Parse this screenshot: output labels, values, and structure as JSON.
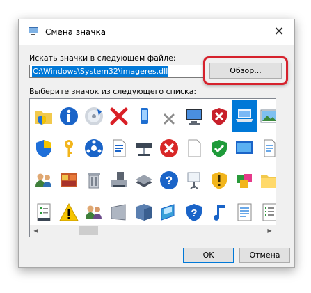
{
  "window": {
    "title": "Смена значка",
    "close_glyph": "✕"
  },
  "file_section": {
    "label": "Искать значки в следующем файле:",
    "path_value": "C:\\Windows\\System32\\imageres.dll",
    "browse_label": "Обзор..."
  },
  "list_section": {
    "label": "Выберите значок из следующего списка:"
  },
  "icons": [
    "folder-shield-icon",
    "info-icon",
    "dvd-drive-icon",
    "red-x-icon",
    "mobile-device-icon",
    "gray-x-icon",
    "computer-monitor-icon",
    "red-shield-x-icon",
    "laptop-icon",
    "picture-icon",
    "uac-shield-icon",
    "key-icon",
    "network-icon",
    "document-icon",
    "network-adapter-icon",
    "error-icon",
    "blank-document-icon",
    "green-shield-check-icon",
    "screen-icon",
    "printer-document-icon",
    "users-icon",
    "image-gallery-icon",
    "trash-icon",
    "computer-tower-icon",
    "scanner-icon",
    "help-icon",
    "projector-icon",
    "warning-shield-icon",
    "programs-icon",
    "folder-icon",
    "checklist-icon",
    "warning-icon",
    "users-group-icon",
    "blank-panel-icon",
    "cube-icon",
    "image-frame-icon",
    "help-shield-icon",
    "music-note-icon",
    "spreadsheet-icon",
    "list-document-icon"
  ],
  "selected_index": 8,
  "buttons": {
    "ok": "OK",
    "cancel": "Отмена"
  },
  "scroll": {
    "left_arrow": "◀",
    "right_arrow": "▶"
  }
}
